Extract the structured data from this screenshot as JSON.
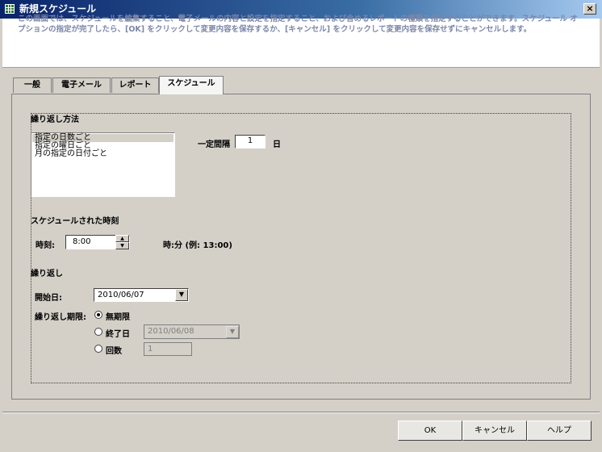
{
  "window": {
    "title": "新規スケジュール",
    "close_glyph": "×"
  },
  "header": {
    "description": "この画面では、スケジュールを編集すること、電子メールの内容と設定を指定すること、および含めるレポートの種類を指定することができます。スケジュール オプションの指定が完了したら、[OK] をクリックして変更内容を保存するか、[キャンセル] をクリックして変更内容を保存せずにキャンセルします。"
  },
  "tabs": [
    {
      "label": "一般"
    },
    {
      "label": "電子メール"
    },
    {
      "label": "レポート"
    },
    {
      "label": "スケジュール",
      "active": true
    }
  ],
  "recurrence": {
    "heading": "繰り返し方法",
    "options": [
      "指定の日数ごと",
      "指定の曜日ごと",
      "月の指定の日付ごと"
    ],
    "selected_index": 0,
    "interval_label": "一定間隔",
    "interval_value": "1",
    "interval_unit": "日"
  },
  "scheduled_time": {
    "heading": "スケジュールされた時刻",
    "time_label": "時刻:",
    "time_value": "8:00",
    "format_hint": "時:分 (例: 13:00)"
  },
  "repeat": {
    "heading": "繰り返し",
    "start_label": "開始日:",
    "start_value": "2010/06/07",
    "period_label": "繰り返し期限:",
    "options": [
      {
        "label": "無期限",
        "checked": true
      },
      {
        "label": "終了日",
        "checked": false,
        "value": "2010/06/08"
      },
      {
        "label": "回数",
        "checked": false,
        "value": "1"
      }
    ]
  },
  "footer": {
    "ok_label": "OK",
    "cancel_label": "キャンセル",
    "help_label": "ヘルプ"
  },
  "colors": {
    "titlebar_start": "#0a246a",
    "header_text": "#7c86a8",
    "dialog_bg": "#d4d0c8"
  }
}
